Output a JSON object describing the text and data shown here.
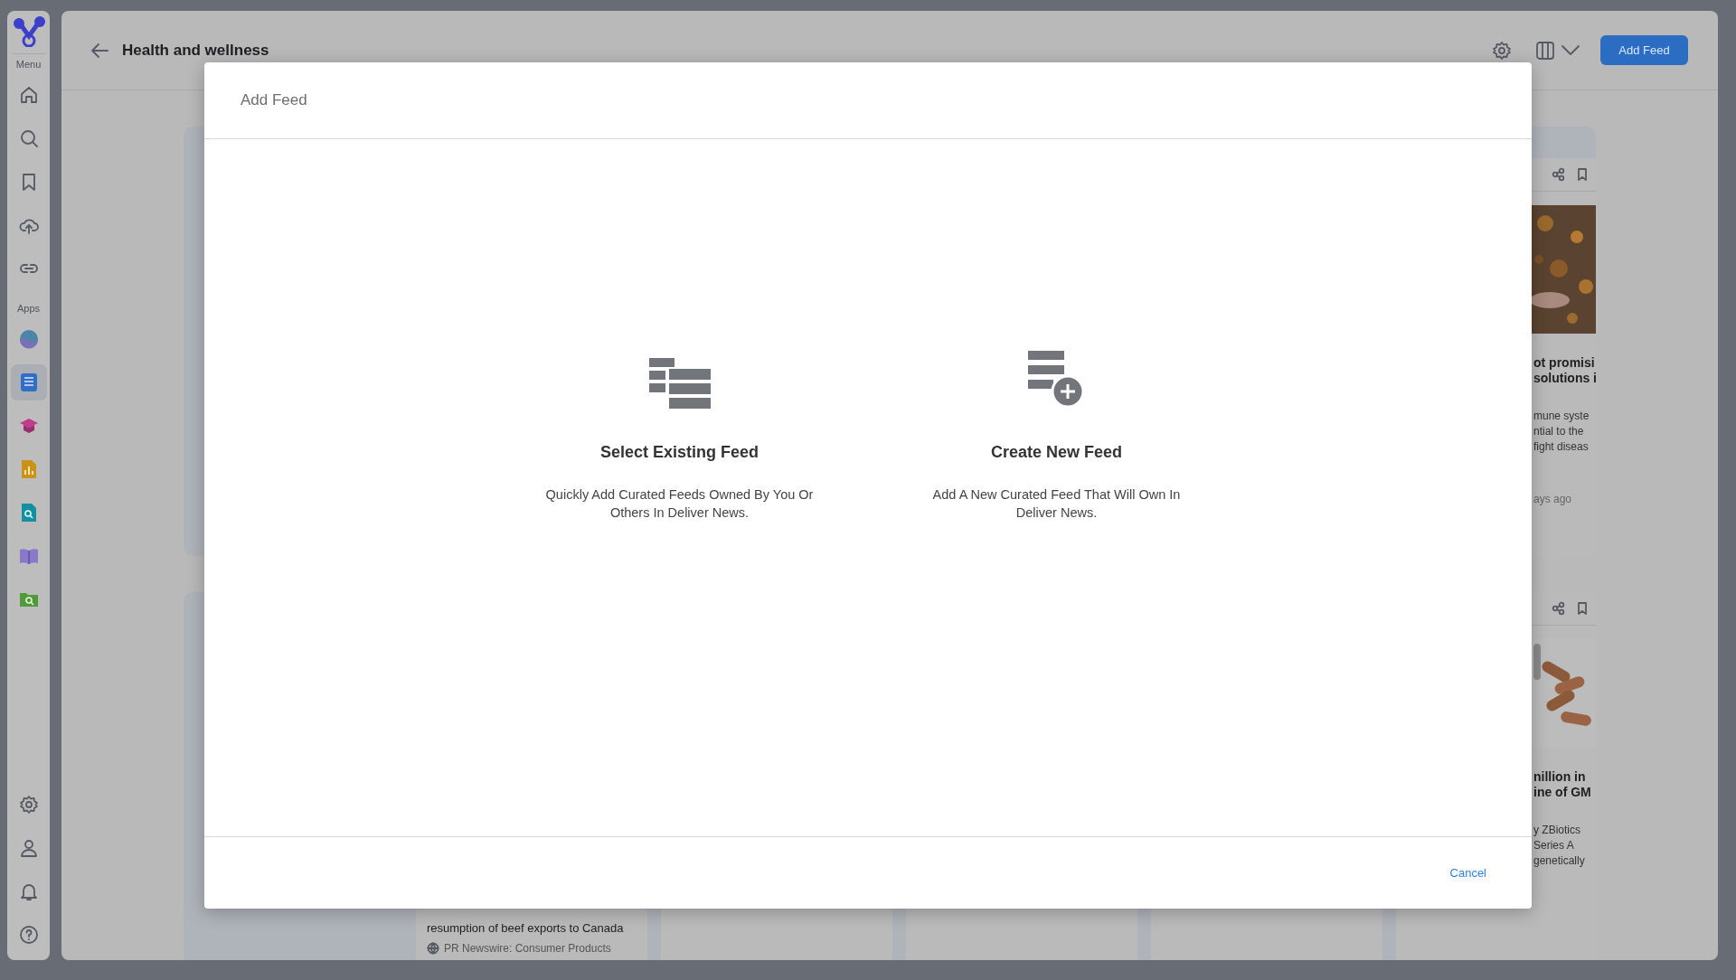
{
  "sidebar": {
    "menu_label": "Menu",
    "apps_label": "Apps",
    "apps": [
      {
        "selected": false
      },
      {
        "selected": true
      },
      {
        "selected": false
      },
      {
        "selected": false
      },
      {
        "selected": false
      },
      {
        "selected": false
      },
      {
        "selected": false
      }
    ]
  },
  "header": {
    "title": "Health and wellness",
    "add_button": "Add Feed"
  },
  "feed_peek": {
    "top_card": {
      "title": "ot promisi\nsolutions i",
      "summary": "mune syste\nntial to the\nfight diseas",
      "time": "ays ago"
    },
    "bottom_card": {
      "title": "nillion in\nine of GM",
      "summary": "y ZBiotics\nSeries A\ngenetically"
    },
    "bottom_row": {
      "headline": "resumption of beef exports to Canada",
      "source": "PR Newswire: Consumer Products"
    }
  },
  "dialog": {
    "title": "Add Feed",
    "options": [
      {
        "kind": "existing",
        "title": "Select Existing Feed",
        "description": "Quickly Add Curated Feeds Owned By You Or Others In Deliver News."
      },
      {
        "kind": "create",
        "title": "Create New Feed",
        "description": "Add A New Curated Feed That Will Own In Deliver News."
      }
    ],
    "cancel": "Cancel"
  }
}
